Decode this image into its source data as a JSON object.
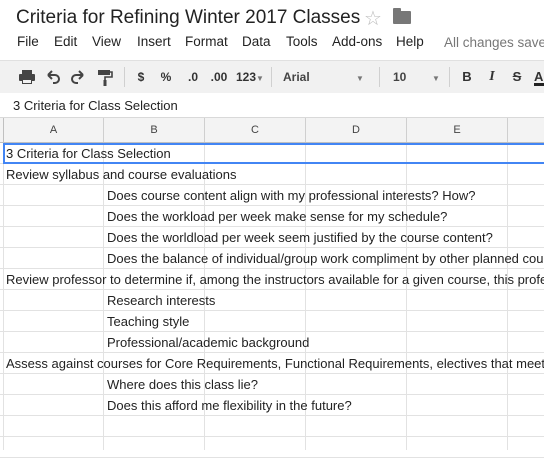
{
  "document": {
    "title": "Criteria for Refining Winter 2017 Classes",
    "save_status": "All changes saved"
  },
  "menu": [
    "File",
    "Edit",
    "View",
    "Insert",
    "Format",
    "Data",
    "Tools",
    "Add-ons",
    "Help"
  ],
  "toolbar": {
    "currency": "$",
    "percent": "%",
    "decrease_decimal": ".0",
    "increase_decimal": ".00",
    "number_format": "123",
    "font": "Arial",
    "font_size": "10",
    "bold": "B",
    "italic": "I",
    "strike": "S",
    "text_color": "A"
  },
  "formula_bar": {
    "value": "3 Criteria for Class Selection"
  },
  "columns": [
    "A",
    "B",
    "C",
    "D",
    "E"
  ],
  "rows": [
    {
      "col": "A",
      "text": "3 Criteria for Class Selection"
    },
    {
      "col": "A",
      "text": "Review syllabus and course evaluations"
    },
    {
      "col": "B",
      "text": "Does course content align with my professional interests? How?"
    },
    {
      "col": "B",
      "text": "Does the workload per week make sense for my schedule?"
    },
    {
      "col": "B",
      "text": "Does the worldload per week seem justified by the course content?"
    },
    {
      "col": "B",
      "text": "Does the balance of individual/group work compliment by other planned cou"
    },
    {
      "col": "A",
      "text": "Review professor to determine if, among the instructors available for a given course, this profe"
    },
    {
      "col": "B",
      "text": "Research interests"
    },
    {
      "col": "B",
      "text": "Teaching style"
    },
    {
      "col": "B",
      "text": "Professional/academic background"
    },
    {
      "col": "A",
      "text": "Assess against courses for Core Requirements, Functional Requirements, electives that meet"
    },
    {
      "col": "B",
      "text": "Where does this class lie?"
    },
    {
      "col": "B",
      "text": "Does this afford me flexibility in the future?"
    },
    {
      "col": "",
      "text": ""
    },
    {
      "col": "",
      "text": ""
    }
  ]
}
